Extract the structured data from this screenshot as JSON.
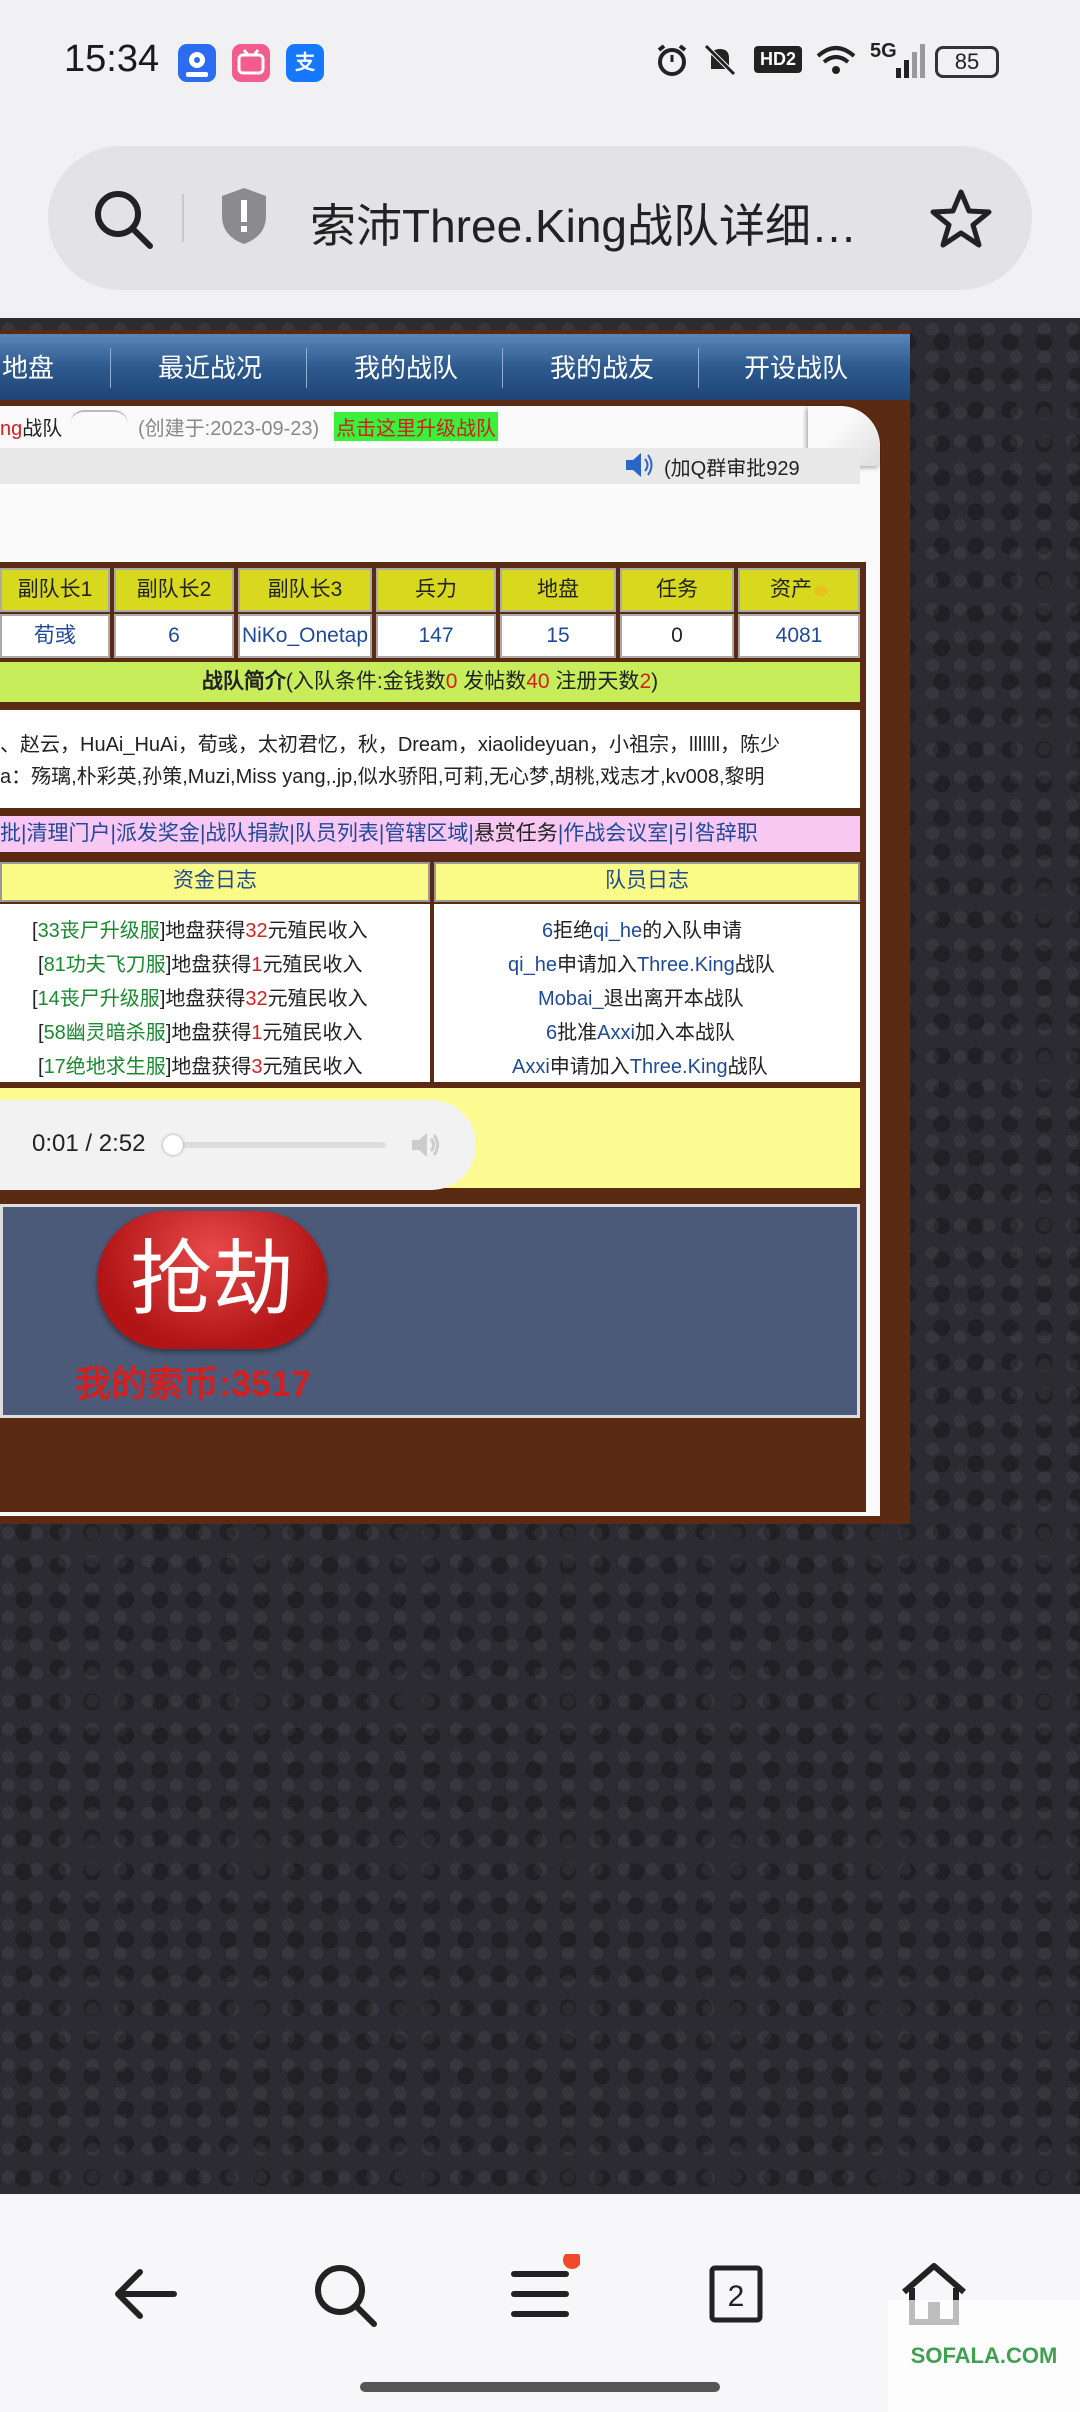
{
  "status_bar": {
    "time": "15:34",
    "battery": "85",
    "network": "5G",
    "hd_label": "HD2",
    "apps": [
      {
        "icon": "map-pin-icon",
        "color": "#2b6cf0"
      },
      {
        "icon": "bilibili-icon",
        "color": "#f25d8e"
      },
      {
        "icon": "alipay-icon",
        "color": "#1677ff",
        "glyph": "支"
      }
    ]
  },
  "browser": {
    "page_title": "索沛Three.King战队详细…"
  },
  "nav": {
    "items": [
      "地盘",
      "最近战况",
      "我的战队",
      "我的战友",
      "开设战队"
    ]
  },
  "team_header": {
    "name_prefix": "ng",
    "team_suffix": "战队",
    "created": "(创建于:2023-09-23)",
    "upgrade_link": "点击这里升级战队",
    "qq_note": "(加Q群审批929"
  },
  "stats": {
    "headers": [
      "副队长1",
      "副队长2",
      "副队长3",
      "兵力",
      "地盘",
      "任务",
      "资产"
    ],
    "values": [
      "荀彧",
      "6",
      "NiKo_Onetap",
      "147",
      "15",
      "0",
      "4081"
    ]
  },
  "intro": {
    "label": "战队简介",
    "cond_open": "(入队条件:金钱数",
    "money": "0",
    "posts_label": " 发帖数",
    "posts": "40",
    "days_label": " 注册天数",
    "days": "2",
    "cond_close": ")"
  },
  "members": {
    "line1": "、赵云，HuAi_HuAi，荀彧，太初君忆，秋，Dream，xiaolideyuan，小祖宗，lllllll，陈少",
    "line2": "a：殇璃,朴彩英,孙策,Muzi,Miss yang,.jp,似水骄阳,可莉,无心梦,胡桃,戏志才,kv008,黎明"
  },
  "admin_links": {
    "items": [
      "批",
      "清理门户",
      "派发奖金",
      "战队捐款",
      "队员列表",
      "管辖区域",
      "悬赏任务",
      "作战会议室",
      "引咎辞职"
    ]
  },
  "fund_log": {
    "title": "资金日志",
    "entries": [
      {
        "open": "[",
        "name": "33丧尸升级服",
        "mid": "]地盘获得",
        "amount": "32",
        "tail": "元殖民收入"
      },
      {
        "open": "[",
        "name": "81功夫飞刀服",
        "mid": "]地盘获得",
        "amount": "1",
        "tail": "元殖民收入"
      },
      {
        "open": "[",
        "name": "14丧尸升级服",
        "mid": "]地盘获得",
        "amount": "32",
        "tail": "元殖民收入"
      },
      {
        "open": "[",
        "name": "58幽灵暗杀服",
        "mid": "]地盘获得",
        "amount": "1",
        "tail": "元殖民收入"
      },
      {
        "open": "[",
        "name": "17绝地求生服",
        "mid": "]地盘获得",
        "amount": "3",
        "tail": "元殖民收入"
      }
    ]
  },
  "member_log": {
    "title": "队员日志",
    "entries": [
      {
        "a": "6",
        "b": "拒绝",
        "c": "qi_he",
        "d": "的入队申请"
      },
      {
        "a": "qi_he",
        "b": "申请加入",
        "c": "Three.King",
        "d": "战队"
      },
      {
        "a": "Mobai_",
        "b": "退出离开本战队",
        "c": "",
        "d": ""
      },
      {
        "a": "6",
        "b": "批准",
        "c": "Axxi",
        "d": "加入本战队"
      },
      {
        "a": "Axxi",
        "b": "申请加入",
        "c": "Three.King",
        "d": "战队"
      }
    ]
  },
  "audio": {
    "time": "0:01 / 2:52",
    "progress": 0.006
  },
  "rob": {
    "button": "抢劫",
    "coins": "我的索币:3517"
  },
  "watermark": "SOFALA.COM"
}
